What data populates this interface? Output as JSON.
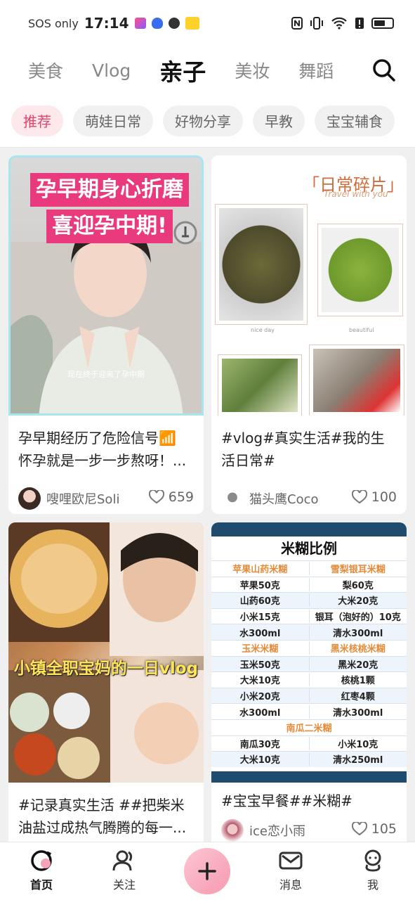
{
  "status_bar": {
    "carrier": "SOS only",
    "time": "17:14"
  },
  "top_tabs": [
    "美食",
    "Vlog",
    "亲子",
    "美妆",
    "舞蹈"
  ],
  "top_tab_active": "亲子",
  "sub_tabs": [
    "推荐",
    "萌娃日常",
    "好物分享",
    "早教",
    "宝宝辅食"
  ],
  "sub_tab_active": "推荐",
  "cards": [
    {
      "thumb_headline_1": "孕早期身心折磨",
      "thumb_headline_2": "喜迎孕中期!",
      "thumb_caption": "现在终于迎来了孕中期",
      "title_line1": "孕早期经历了危险信号📶",
      "title_line2": "怀孕就是一步一步熬呀！...",
      "author": "嗖哩欧尼Soli",
      "likes": "659"
    },
    {
      "thumb_heading": "「日常碎片」",
      "thumb_sub": "Travel with you",
      "photo_caption_1": "nice day",
      "photo_caption_2": "beautiful",
      "title_line1": "#vlog#真实生活#我的生",
      "title_line2": "活日常#",
      "author": "猫头鹰Coco",
      "likes": "100"
    },
    {
      "thumb_banner": "小镇全职宝妈的一日vlog",
      "title_line1": "#记录真实生活 ##把柴米",
      "title_line2": "油盐过成热气腾腾的每一..."
    },
    {
      "table_title": "米糊比例",
      "table_rows": [
        {
          "left": "苹果山药米糊",
          "right": "雪梨银耳米糊",
          "head": true
        },
        {
          "left": "苹果50克",
          "right": "梨60克"
        },
        {
          "left": "山药60克",
          "right": "大米20克"
        },
        {
          "left": "小米15克",
          "right": "银耳（泡好的）10克"
        },
        {
          "left": "水300ml",
          "right": "清水300ml"
        },
        {
          "left": "玉米米糊",
          "right": "黑米核桃米糊",
          "head": true
        },
        {
          "left": "玉米50克",
          "right": "黑米20克"
        },
        {
          "left": "大米10克",
          "right": "核桃1颗"
        },
        {
          "left": "小米20克",
          "right": "红枣4颗"
        },
        {
          "left": "水300ml",
          "right": "清水300ml"
        },
        {
          "full": "南瓜二米糊",
          "head": true
        },
        {
          "left": "南瓜30克",
          "right": "小米10克"
        },
        {
          "left": "大米10克",
          "right": "清水250ml"
        }
      ],
      "title_line1": "#宝宝早餐##米糊#",
      "author": "ice恋小雨",
      "likes": "105"
    }
  ],
  "bottom_nav": {
    "home": "首页",
    "follow": "关注",
    "messages": "消息",
    "me": "我"
  },
  "colors": {
    "accent_pink": "#e0456a",
    "chip_active_bg": "#fde8ec",
    "plus_button": "#f79ab0"
  }
}
